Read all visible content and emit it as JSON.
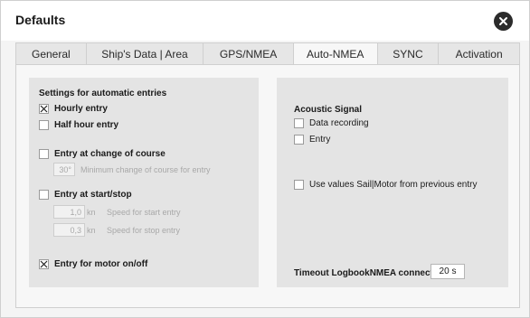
{
  "window": {
    "title": "Defaults"
  },
  "tabs": [
    {
      "label": "General"
    },
    {
      "label": "Ship's Data  | Area"
    },
    {
      "label": "GPS/NMEA"
    },
    {
      "label": "Auto-NMEA",
      "active": true
    },
    {
      "label": "SYNC"
    },
    {
      "label": "Activation"
    }
  ],
  "left_panel": {
    "heading": "Settings for automatic entries",
    "hourly": {
      "label": "Hourly entry",
      "checked": true
    },
    "half_hour": {
      "label": "Half hour entry",
      "checked": false
    },
    "course_change": {
      "label": "Entry at change of course",
      "checked": false,
      "min_change_value": "30°",
      "min_change_hint": "Minimum change of course for entry"
    },
    "start_stop": {
      "label": "Entry at start/stop",
      "checked": false,
      "start_speed_value": "1,0",
      "start_speed_unit": "kn",
      "start_speed_hint": "Speed for start entry",
      "stop_speed_value": "0,3",
      "stop_speed_unit": "kn",
      "stop_speed_hint": "Speed for stop entry"
    },
    "motor": {
      "label": "Entry for motor on/off",
      "checked": true
    }
  },
  "right_panel": {
    "heading": "Acoustic Signal",
    "data_recording": {
      "label": "Data recording",
      "checked": false
    },
    "entry": {
      "label": "Entry",
      "checked": false
    },
    "sail_motor": {
      "label": "Use values Sail|Motor from previous entry",
      "checked": false
    },
    "timeout_label": "Timeout LogbookNMEA connect",
    "timeout_value": "20 s"
  },
  "icons": {
    "close": "close-icon",
    "check": "check-icon"
  },
  "colors": {
    "tab_bar": "#e6e6e6",
    "panel": "#e4e4e4",
    "close_button": "#2b2b2b"
  }
}
